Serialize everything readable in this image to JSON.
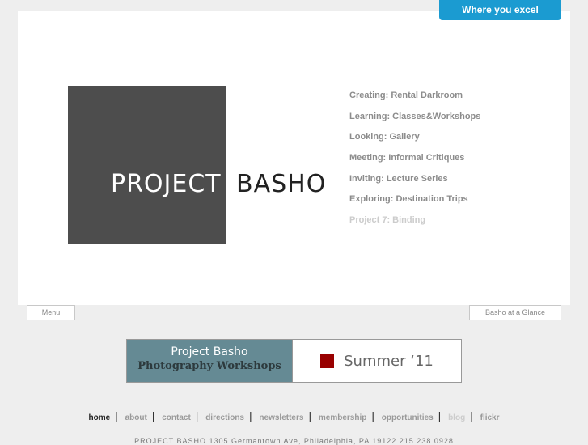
{
  "header": {
    "tab_button": "Where you excel"
  },
  "logo": {
    "word1": "PROJECT",
    "word2": "BASHO"
  },
  "menu": {
    "items": [
      {
        "label": "Creating: Rental Darkroom"
      },
      {
        "label": "Learning: Classes&Workshops"
      },
      {
        "label": "Looking: Gallery"
      },
      {
        "label": "Meeting: Informal Critiques"
      },
      {
        "label": "Inviting: Lecture Series"
      },
      {
        "label": "Exploring: Destination Trips"
      },
      {
        "label": "Project 7: Binding"
      }
    ]
  },
  "buttons": {
    "menu": "Menu",
    "glance": "Basho at a Glance"
  },
  "banner": {
    "line1": "Project Basho",
    "line2": "Photography Workshops",
    "season": "Summer ‘11"
  },
  "footer": {
    "nav": [
      "home",
      "about",
      "contact",
      "directions",
      "newsletters",
      "membership",
      "opportunities",
      "blog",
      "flickr"
    ],
    "separator": "|",
    "address": "PROJECT BASHO   1305 Germantown Ave, Philadelphia, PA 19122   215.238.0928"
  },
  "colors": {
    "accent": "#1b9bd1",
    "banner_teal": "#658a94",
    "banner_red": "#990000",
    "logo_gray": "#4d4d4d"
  }
}
